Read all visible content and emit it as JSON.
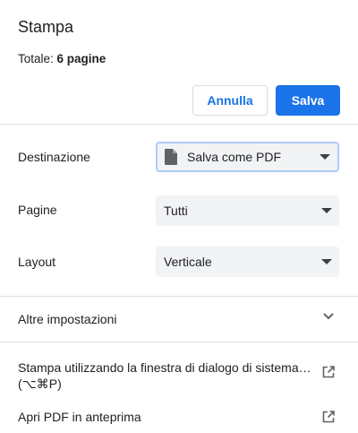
{
  "dialog": {
    "title": "Stampa",
    "total_label": "Totale: ",
    "total_count": "6 pagine"
  },
  "buttons": {
    "cancel_label": "Annulla",
    "save_label": "Salva"
  },
  "settings": {
    "destination": {
      "label": "Destinazione",
      "value": "Salva come PDF",
      "icon": "document-icon"
    },
    "pages": {
      "label": "Pagine",
      "value": "Tutti"
    },
    "layout": {
      "label": "Layout",
      "value": "Verticale"
    }
  },
  "more_settings": {
    "label": "Altre impostazioni",
    "icon": "chevron-down-icon"
  },
  "links": {
    "system_dialog": {
      "line1": "Stampa utilizzando la finestra di dialogo di sistema…",
      "line2": "(⌥⌘P)",
      "icon": "open-external-icon"
    },
    "open_pdf": {
      "label": "Apri PDF in anteprima",
      "icon": "open-external-icon"
    }
  },
  "colors": {
    "accent": "#1a73e8",
    "select_bg": "#f1f3f4",
    "focus_ring": "#aecbfa",
    "divider": "#e0e0e0"
  }
}
